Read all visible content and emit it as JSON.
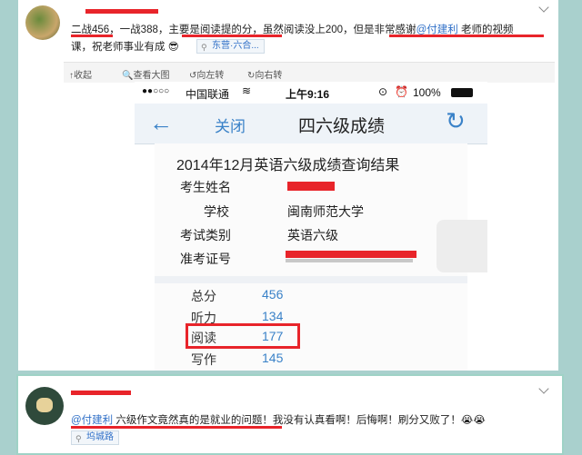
{
  "post1": {
    "text_a": "二战456，一战388，主要是阅读提的分，虽然阅读没上200，但是非常感谢",
    "mention": "@付建利",
    "text_b": " 老师的视频",
    "text_line2": "课，祝老师事业有成",
    "emoji": "😎",
    "location": "东营·六合..."
  },
  "toolbar": {
    "collapse": "↑收起",
    "view_large": "查看大图",
    "rotate_left": "向左转",
    "rotate_right": "向右转"
  },
  "phone": {
    "signal": "●●○○○",
    "carrier": "中国联通",
    "time": "上午9:16",
    "battery": "100%",
    "close": "关闭",
    "nav_title": "四六级成绩",
    "result_title": "2014年12月英语六级成绩查询结果",
    "fields": [
      {
        "label": "考生姓名",
        "value": ""
      },
      {
        "label": "学校",
        "value": "闽南师范大学"
      },
      {
        "label": "考试类别",
        "value": "英语六级"
      },
      {
        "label": "准考证号",
        "value": ""
      }
    ],
    "scores": [
      {
        "label": "总分",
        "value": "456"
      },
      {
        "label": "听力",
        "value": "134"
      },
      {
        "label": "阅读",
        "value": "177"
      },
      {
        "label": "写作",
        "value": "145"
      }
    ]
  },
  "post2": {
    "mention": "@付建利",
    "text": " 六级作文竟然真的是就业的问题！我没有认真看啊！后悔啊！刷分又败了！",
    "emoji": "😭😭",
    "location": "坞城路"
  },
  "colors": {
    "accent_blue": "#2f6fc7",
    "redaction_red": "#e8242a",
    "score_blue": "#3a82c8"
  }
}
